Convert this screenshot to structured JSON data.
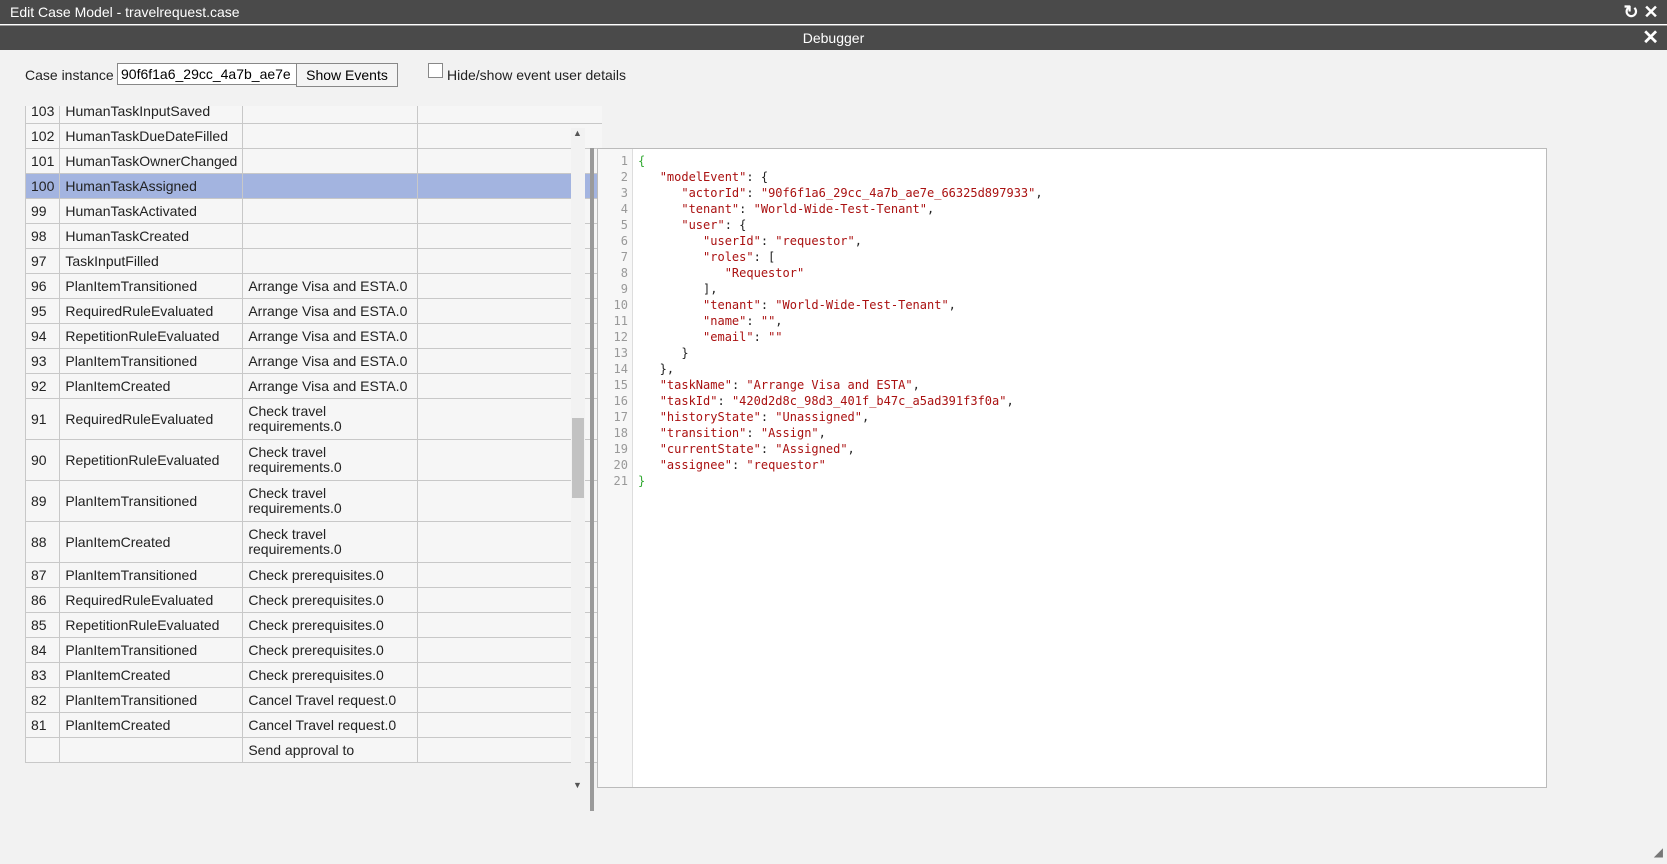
{
  "window": {
    "title": "Edit Case Model - travelrequest.case"
  },
  "debugger": {
    "title": "Debugger",
    "case_label": "Case instance",
    "case_value": "90f6f1a6_29cc_4a7b_ae7e",
    "show_events_label": "Show Events",
    "toggle_label": "Hide/show event user details"
  },
  "events": [
    {
      "num": "103",
      "type": "HumanTaskInputSaved",
      "item": ""
    },
    {
      "num": "102",
      "type": "HumanTaskDueDateFilled",
      "item": ""
    },
    {
      "num": "101",
      "type": "HumanTaskOwnerChanged",
      "item": ""
    },
    {
      "num": "100",
      "type": "HumanTaskAssigned",
      "item": "",
      "selected": true
    },
    {
      "num": "99",
      "type": "HumanTaskActivated",
      "item": ""
    },
    {
      "num": "98",
      "type": "HumanTaskCreated",
      "item": ""
    },
    {
      "num": "97",
      "type": "TaskInputFilled",
      "item": ""
    },
    {
      "num": "96",
      "type": "PlanItemTransitioned",
      "item": "Arrange Visa and ESTA.0"
    },
    {
      "num": "95",
      "type": "RequiredRuleEvaluated",
      "item": "Arrange Visa and ESTA.0"
    },
    {
      "num": "94",
      "type": "RepetitionRuleEvaluated",
      "item": "Arrange Visa and ESTA.0"
    },
    {
      "num": "93",
      "type": "PlanItemTransitioned",
      "item": "Arrange Visa and ESTA.0"
    },
    {
      "num": "92",
      "type": "PlanItemCreated",
      "item": "Arrange Visa and ESTA.0"
    },
    {
      "num": "91",
      "type": "RequiredRuleEvaluated",
      "item": "Check travel requirements.0"
    },
    {
      "num": "90",
      "type": "RepetitionRuleEvaluated",
      "item": "Check travel requirements.0"
    },
    {
      "num": "89",
      "type": "PlanItemTransitioned",
      "item": "Check travel requirements.0"
    },
    {
      "num": "88",
      "type": "PlanItemCreated",
      "item": "Check travel requirements.0"
    },
    {
      "num": "87",
      "type": "PlanItemTransitioned",
      "item": "Check prerequisites.0"
    },
    {
      "num": "86",
      "type": "RequiredRuleEvaluated",
      "item": "Check prerequisites.0"
    },
    {
      "num": "85",
      "type": "RepetitionRuleEvaluated",
      "item": "Check prerequisites.0"
    },
    {
      "num": "84",
      "type": "PlanItemTransitioned",
      "item": "Check prerequisites.0"
    },
    {
      "num": "83",
      "type": "PlanItemCreated",
      "item": "Check prerequisites.0"
    },
    {
      "num": "82",
      "type": "PlanItemTransitioned",
      "item": "Cancel Travel request.0"
    },
    {
      "num": "81",
      "type": "PlanItemCreated",
      "item": "Cancel Travel request.0"
    },
    {
      "num": "",
      "type": "",
      "item": "Send approval to"
    }
  ],
  "json_lines": [
    [
      {
        "t": "{",
        "c": "b"
      }
    ],
    [
      {
        "t": "   "
      },
      {
        "t": "\"modelEvent\"",
        "c": "k"
      },
      {
        "t": ": {"
      }
    ],
    [
      {
        "t": "      "
      },
      {
        "t": "\"actorId\"",
        "c": "k"
      },
      {
        "t": ": "
      },
      {
        "t": "\"90f6f1a6_29cc_4a7b_ae7e_66325d897933\"",
        "c": "k"
      },
      {
        "t": ","
      }
    ],
    [
      {
        "t": "      "
      },
      {
        "t": "\"tenant\"",
        "c": "k"
      },
      {
        "t": ": "
      },
      {
        "t": "\"World-Wide-Test-Tenant\"",
        "c": "k"
      },
      {
        "t": ","
      }
    ],
    [
      {
        "t": "      "
      },
      {
        "t": "\"user\"",
        "c": "k"
      },
      {
        "t": ": {"
      }
    ],
    [
      {
        "t": "         "
      },
      {
        "t": "\"userId\"",
        "c": "k"
      },
      {
        "t": ": "
      },
      {
        "t": "\"requestor\"",
        "c": "k"
      },
      {
        "t": ","
      }
    ],
    [
      {
        "t": "         "
      },
      {
        "t": "\"roles\"",
        "c": "k"
      },
      {
        "t": ": ["
      }
    ],
    [
      {
        "t": "            "
      },
      {
        "t": "\"Requestor\"",
        "c": "k"
      }
    ],
    [
      {
        "t": "         ],"
      }
    ],
    [
      {
        "t": "         "
      },
      {
        "t": "\"tenant\"",
        "c": "k"
      },
      {
        "t": ": "
      },
      {
        "t": "\"World-Wide-Test-Tenant\"",
        "c": "k"
      },
      {
        "t": ","
      }
    ],
    [
      {
        "t": "         "
      },
      {
        "t": "\"name\"",
        "c": "k"
      },
      {
        "t": ": "
      },
      {
        "t": "\"\"",
        "c": "k"
      },
      {
        "t": ","
      }
    ],
    [
      {
        "t": "         "
      },
      {
        "t": "\"email\"",
        "c": "k"
      },
      {
        "t": ": "
      },
      {
        "t": "\"\"",
        "c": "k"
      }
    ],
    [
      {
        "t": "      }"
      }
    ],
    [
      {
        "t": "   },"
      }
    ],
    [
      {
        "t": "   "
      },
      {
        "t": "\"taskName\"",
        "c": "k"
      },
      {
        "t": ": "
      },
      {
        "t": "\"Arrange Visa and ESTA\"",
        "c": "k"
      },
      {
        "t": ","
      }
    ],
    [
      {
        "t": "   "
      },
      {
        "t": "\"taskId\"",
        "c": "k"
      },
      {
        "t": ": "
      },
      {
        "t": "\"420d2d8c_98d3_401f_b47c_a5ad391f3f0a\"",
        "c": "k"
      },
      {
        "t": ","
      }
    ],
    [
      {
        "t": "   "
      },
      {
        "t": "\"historyState\"",
        "c": "k"
      },
      {
        "t": ": "
      },
      {
        "t": "\"Unassigned\"",
        "c": "k"
      },
      {
        "t": ","
      }
    ],
    [
      {
        "t": "   "
      },
      {
        "t": "\"transition\"",
        "c": "k"
      },
      {
        "t": ": "
      },
      {
        "t": "\"Assign\"",
        "c": "k"
      },
      {
        "t": ","
      }
    ],
    [
      {
        "t": "   "
      },
      {
        "t": "\"currentState\"",
        "c": "k"
      },
      {
        "t": ": "
      },
      {
        "t": "\"Assigned\"",
        "c": "k"
      },
      {
        "t": ","
      }
    ],
    [
      {
        "t": "   "
      },
      {
        "t": "\"assignee\"",
        "c": "k"
      },
      {
        "t": ": "
      },
      {
        "t": "\"requestor\"",
        "c": "k"
      }
    ],
    [
      {
        "t": "}",
        "c": "b"
      }
    ]
  ],
  "icons": {
    "refresh": "refresh-icon",
    "close": "close-icon"
  }
}
